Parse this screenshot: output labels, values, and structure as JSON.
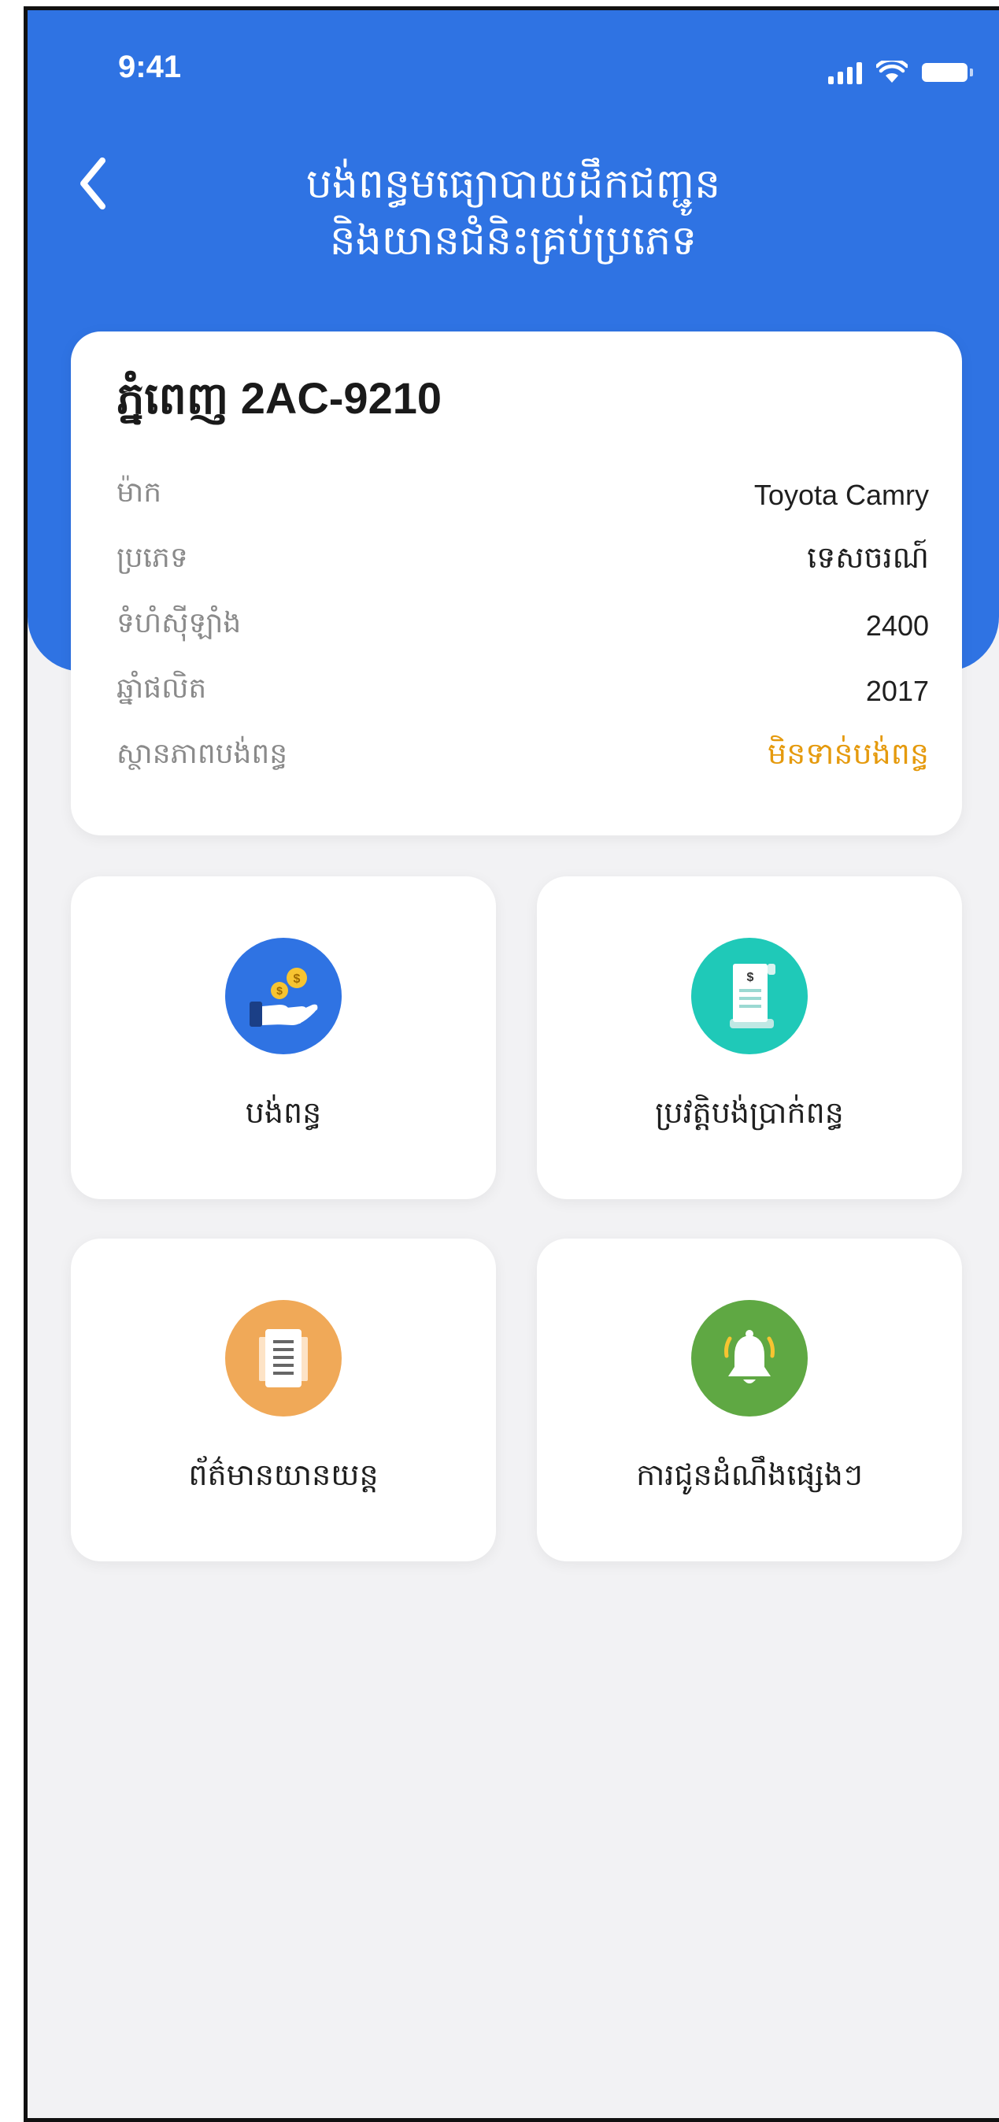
{
  "status_bar": {
    "time": "9:41"
  },
  "header": {
    "title_line1": "បង់ពន្ធមធ្យោបាយដឹកជញ្ជូន",
    "title_line2": "និងយានជំនិះគ្រប់ប្រភេទ"
  },
  "vehicle": {
    "plate": "ភ្នំពេញ 2AC-9210",
    "rows": [
      {
        "label": "ម៉ាក",
        "value": "Toyota Camry"
      },
      {
        "label": "ប្រភេទ",
        "value": "ទេសចរណ៍"
      },
      {
        "label": "ទំហំស៊ីឡាំង",
        "value": "2400"
      },
      {
        "label": "ឆ្នាំផលិត",
        "value": "2017"
      },
      {
        "label": "ស្ថានភាពបង់ពន្ធ",
        "value": "មិនទាន់បង់ពន្ធ"
      }
    ]
  },
  "menu": {
    "tiles": [
      {
        "label": "បង់ពន្ធ",
        "icon": "pay-tax-icon",
        "color": "#2f73e3"
      },
      {
        "label": "ប្រវត្តិបង់ប្រាក់ពន្ធ",
        "icon": "receipt-icon",
        "color": "#1fc9b8"
      },
      {
        "label": "ព័ត៌មានយានយន្ត",
        "icon": "document-icon",
        "color": "#f0a958"
      },
      {
        "label": "ការជូនដំណឹងផ្សេងៗ",
        "icon": "bell-icon",
        "color": "#5fa843"
      }
    ]
  },
  "colors": {
    "primary": "#2f73e3",
    "status_unpaid": "#e59a0d",
    "background": "#f2f2f4"
  }
}
